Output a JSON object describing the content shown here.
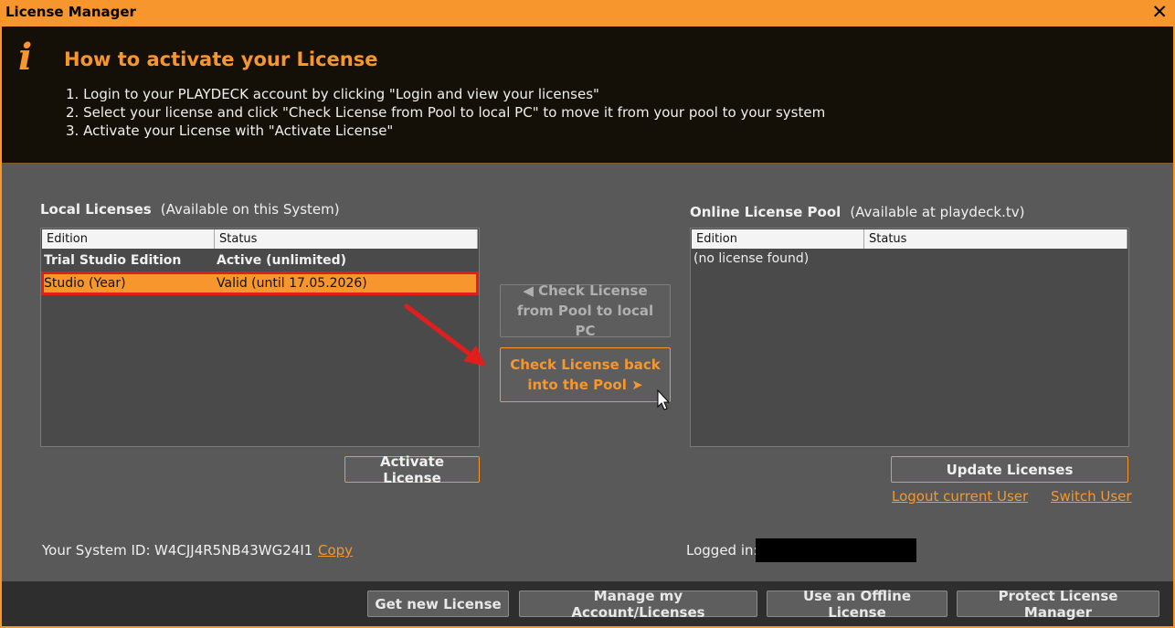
{
  "window": {
    "title": "License Manager",
    "close_glyph": "✕"
  },
  "info": {
    "icon": "i",
    "heading": "How to activate your License",
    "steps": [
      "1. Login to your PLAYDECK account by clicking \"Login and view your licenses\"",
      "2. Select your license and click \"Check License from Pool to local PC\" to move it from your pool to your system",
      "3. Activate your License with \"Activate License\""
    ]
  },
  "local": {
    "title": "Local Licenses",
    "subtitle": "(Available on this System)",
    "columns": [
      "Edition",
      "Status"
    ],
    "rows": [
      {
        "edition": "Trial Studio Edition",
        "status": "Active (unlimited)"
      },
      {
        "edition": "Studio (Year)",
        "status": "Valid (until 17.05.2026)"
      }
    ],
    "activate_label": "Activate License"
  },
  "middle": {
    "from_pool_label": "◀ Check License from Pool to local PC",
    "back_to_pool_label": "Check License back into the Pool ➤"
  },
  "online": {
    "title": "Online License Pool",
    "subtitle": "(Available at playdeck.tv)",
    "columns": [
      "Edition",
      "Status"
    ],
    "empty_text": "(no license found)",
    "update_label": "Update Licenses",
    "logout_label": "Logout current User",
    "switch_label": "Switch User"
  },
  "system": {
    "label": "Your System ID:",
    "id": "W4CJJ4R5NB43WG24I1",
    "copy_label": "Copy"
  },
  "login": {
    "label": "Logged in:"
  },
  "footer": {
    "buttons": [
      "Get new License",
      "Manage my Account/Licenses",
      "Use an Offline License",
      "Protect License Manager"
    ]
  },
  "colors": {
    "accent": "#f7962d",
    "highlight_border": "#e01e1e",
    "arrow": "#e01e1e"
  }
}
